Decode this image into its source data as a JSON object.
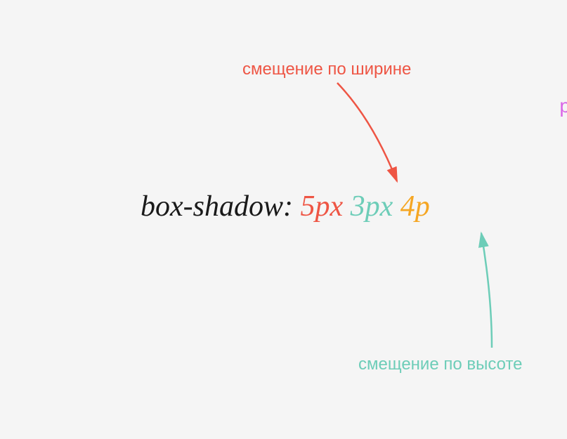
{
  "labels": {
    "width_offset": "смещение по ширине",
    "height_offset": "смещение по высоте",
    "partial_right": "р"
  },
  "css": {
    "property": "box-shadow:",
    "value1": "5px",
    "value2": "3px",
    "value3": "4p"
  },
  "colors": {
    "property": "#1a1a1a",
    "value1": "#ee5544",
    "value2": "#6dcdb8",
    "value3": "#f5a623",
    "partial": "#d966e6"
  }
}
